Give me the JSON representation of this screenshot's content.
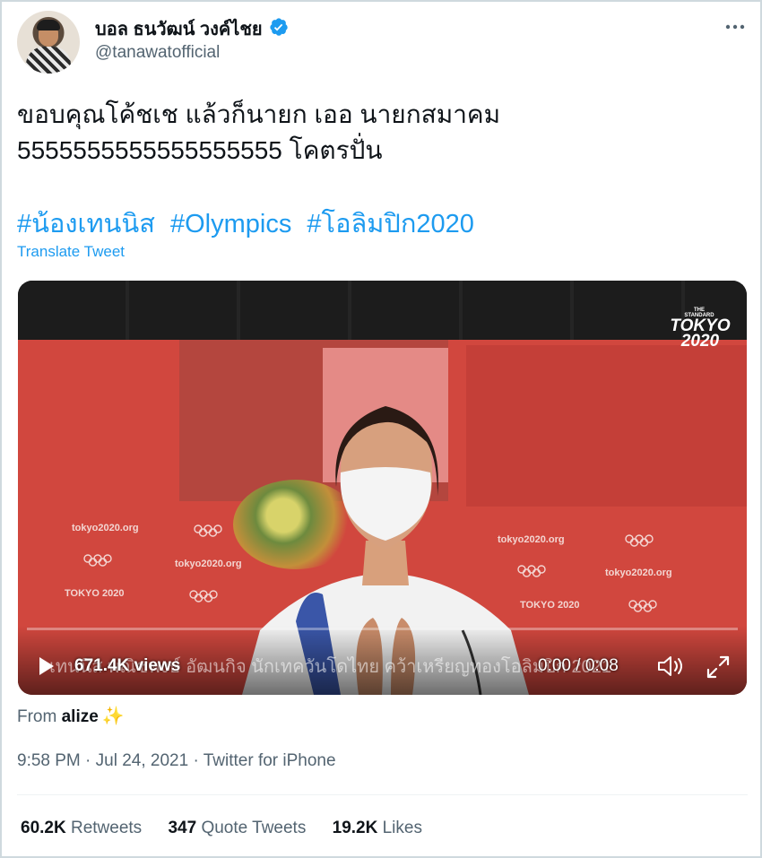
{
  "author": {
    "display_name": "บอล ธนวัฒน์ วงค์ไชย",
    "handle": "@tanawatofficial",
    "verified": true
  },
  "tweet": {
    "lines": [
      "ขอบคุณโค้ชเช แล้วก็นายก เออ นายกสมาคม",
      "5555555555555555555 โคตรปั่น"
    ],
    "hashtags": [
      "#น้องเทนนิส",
      "#Olympics",
      "#โอลิมปิก2020"
    ],
    "translate_label": "Translate Tweet"
  },
  "video": {
    "badge_small": "THE STANDARD",
    "badge_brand": "TOKYO 2020",
    "subtitle": "เทนนิส พณิชพงษ์ อัฒนกิจ นักเทควันโดไทย คว้าเหรียญทองโอลิมปิก 2021",
    "views": "671.4K views",
    "time": "0:00 / 0:08",
    "progress": 0.0,
    "board_text": [
      "tokyo2020.org",
      "tokyo2020.org",
      "tokyo2020.org",
      "TOKYO 2020",
      "tokyo2020.org",
      "TOKYO 2020"
    ]
  },
  "source": {
    "prefix": "From",
    "name": "alize",
    "emoji": "✨"
  },
  "meta": {
    "time": "9:58 PM",
    "date": "Jul 24, 2021",
    "client": "Twitter for iPhone",
    "full": "9:58 PM · Jul 24, 2021 · Twitter for iPhone"
  },
  "stats": {
    "retweets_count": "60.2K",
    "retweets_label": "Retweets",
    "quotes_count": "347",
    "quotes_label": "Quote Tweets",
    "likes_count": "19.2K",
    "likes_label": "Likes"
  },
  "colors": {
    "accent": "#1d9bf0",
    "text": "#0f1419",
    "secondary": "#536471"
  },
  "icons": [
    "verified-icon",
    "more-icon",
    "play-icon",
    "volume-icon",
    "fullscreen-icon",
    "sparkles-icon"
  ]
}
